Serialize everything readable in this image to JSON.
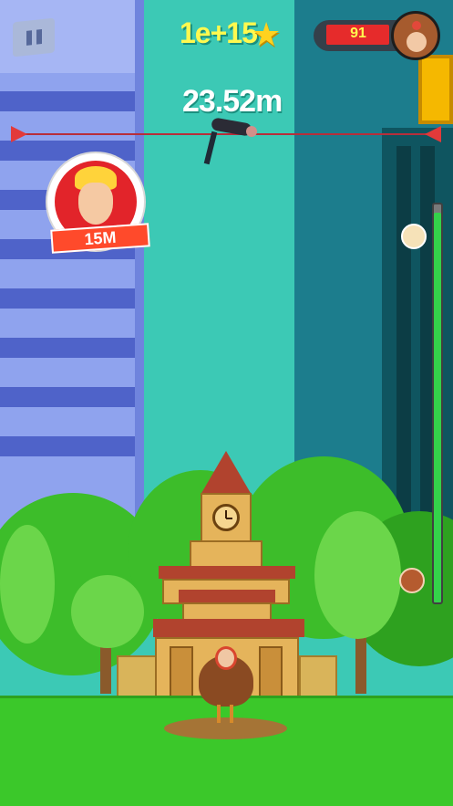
{
  "hud": {
    "pause_icon": "pause-icon",
    "score_text": "1e+15",
    "star_icon": "star-icon",
    "health_value": "91",
    "health_fraction": 0.91,
    "boss_avatar_icon": "turkey-avatar-icon"
  },
  "jump": {
    "height_text": "23.52m",
    "record_badge_text": "15M"
  },
  "progress": {
    "height_bar_fraction": 0.98
  },
  "colors": {
    "score": "#fff94f",
    "health": "#e62b2b",
    "record_line": "#b72e3a",
    "height_bar": "#34d24a"
  }
}
